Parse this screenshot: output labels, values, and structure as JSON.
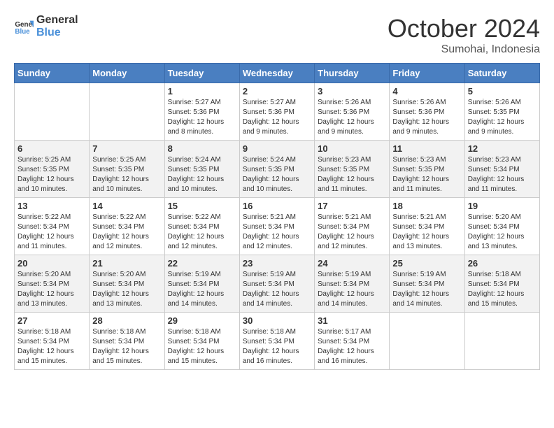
{
  "logo": {
    "line1": "General",
    "line2": "Blue"
  },
  "title": "October 2024",
  "subtitle": "Sumohai, Indonesia",
  "header_days": [
    "Sunday",
    "Monday",
    "Tuesday",
    "Wednesday",
    "Thursday",
    "Friday",
    "Saturday"
  ],
  "weeks": [
    [
      {
        "day": "",
        "info": ""
      },
      {
        "day": "",
        "info": ""
      },
      {
        "day": "1",
        "info": "Sunrise: 5:27 AM\nSunset: 5:36 PM\nDaylight: 12 hours and 8 minutes."
      },
      {
        "day": "2",
        "info": "Sunrise: 5:27 AM\nSunset: 5:36 PM\nDaylight: 12 hours and 9 minutes."
      },
      {
        "day": "3",
        "info": "Sunrise: 5:26 AM\nSunset: 5:36 PM\nDaylight: 12 hours and 9 minutes."
      },
      {
        "day": "4",
        "info": "Sunrise: 5:26 AM\nSunset: 5:36 PM\nDaylight: 12 hours and 9 minutes."
      },
      {
        "day": "5",
        "info": "Sunrise: 5:26 AM\nSunset: 5:35 PM\nDaylight: 12 hours and 9 minutes."
      }
    ],
    [
      {
        "day": "6",
        "info": "Sunrise: 5:25 AM\nSunset: 5:35 PM\nDaylight: 12 hours and 10 minutes."
      },
      {
        "day": "7",
        "info": "Sunrise: 5:25 AM\nSunset: 5:35 PM\nDaylight: 12 hours and 10 minutes."
      },
      {
        "day": "8",
        "info": "Sunrise: 5:24 AM\nSunset: 5:35 PM\nDaylight: 12 hours and 10 minutes."
      },
      {
        "day": "9",
        "info": "Sunrise: 5:24 AM\nSunset: 5:35 PM\nDaylight: 12 hours and 10 minutes."
      },
      {
        "day": "10",
        "info": "Sunrise: 5:23 AM\nSunset: 5:35 PM\nDaylight: 12 hours and 11 minutes."
      },
      {
        "day": "11",
        "info": "Sunrise: 5:23 AM\nSunset: 5:35 PM\nDaylight: 12 hours and 11 minutes."
      },
      {
        "day": "12",
        "info": "Sunrise: 5:23 AM\nSunset: 5:34 PM\nDaylight: 12 hours and 11 minutes."
      }
    ],
    [
      {
        "day": "13",
        "info": "Sunrise: 5:22 AM\nSunset: 5:34 PM\nDaylight: 12 hours and 11 minutes."
      },
      {
        "day": "14",
        "info": "Sunrise: 5:22 AM\nSunset: 5:34 PM\nDaylight: 12 hours and 12 minutes."
      },
      {
        "day": "15",
        "info": "Sunrise: 5:22 AM\nSunset: 5:34 PM\nDaylight: 12 hours and 12 minutes."
      },
      {
        "day": "16",
        "info": "Sunrise: 5:21 AM\nSunset: 5:34 PM\nDaylight: 12 hours and 12 minutes."
      },
      {
        "day": "17",
        "info": "Sunrise: 5:21 AM\nSunset: 5:34 PM\nDaylight: 12 hours and 12 minutes."
      },
      {
        "day": "18",
        "info": "Sunrise: 5:21 AM\nSunset: 5:34 PM\nDaylight: 12 hours and 13 minutes."
      },
      {
        "day": "19",
        "info": "Sunrise: 5:20 AM\nSunset: 5:34 PM\nDaylight: 12 hours and 13 minutes."
      }
    ],
    [
      {
        "day": "20",
        "info": "Sunrise: 5:20 AM\nSunset: 5:34 PM\nDaylight: 12 hours and 13 minutes."
      },
      {
        "day": "21",
        "info": "Sunrise: 5:20 AM\nSunset: 5:34 PM\nDaylight: 12 hours and 13 minutes."
      },
      {
        "day": "22",
        "info": "Sunrise: 5:19 AM\nSunset: 5:34 PM\nDaylight: 12 hours and 14 minutes."
      },
      {
        "day": "23",
        "info": "Sunrise: 5:19 AM\nSunset: 5:34 PM\nDaylight: 12 hours and 14 minutes."
      },
      {
        "day": "24",
        "info": "Sunrise: 5:19 AM\nSunset: 5:34 PM\nDaylight: 12 hours and 14 minutes."
      },
      {
        "day": "25",
        "info": "Sunrise: 5:19 AM\nSunset: 5:34 PM\nDaylight: 12 hours and 14 minutes."
      },
      {
        "day": "26",
        "info": "Sunrise: 5:18 AM\nSunset: 5:34 PM\nDaylight: 12 hours and 15 minutes."
      }
    ],
    [
      {
        "day": "27",
        "info": "Sunrise: 5:18 AM\nSunset: 5:34 PM\nDaylight: 12 hours and 15 minutes."
      },
      {
        "day": "28",
        "info": "Sunrise: 5:18 AM\nSunset: 5:34 PM\nDaylight: 12 hours and 15 minutes."
      },
      {
        "day": "29",
        "info": "Sunrise: 5:18 AM\nSunset: 5:34 PM\nDaylight: 12 hours and 15 minutes."
      },
      {
        "day": "30",
        "info": "Sunrise: 5:18 AM\nSunset: 5:34 PM\nDaylight: 12 hours and 16 minutes."
      },
      {
        "day": "31",
        "info": "Sunrise: 5:17 AM\nSunset: 5:34 PM\nDaylight: 12 hours and 16 minutes."
      },
      {
        "day": "",
        "info": ""
      },
      {
        "day": "",
        "info": ""
      }
    ]
  ]
}
